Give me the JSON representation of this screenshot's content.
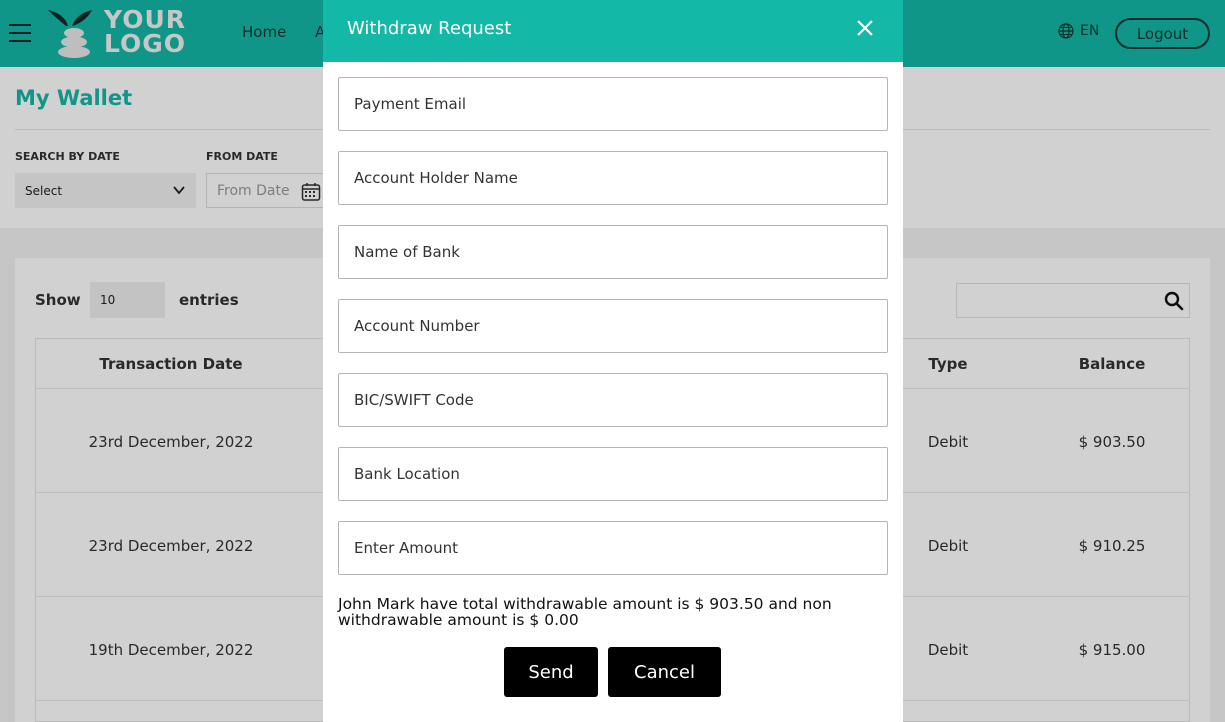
{
  "header": {
    "logo_text": "YOUR LOGO",
    "nav": [
      "Home",
      "A"
    ],
    "language": "EN",
    "logout_label": "Logout"
  },
  "page": {
    "title": "My Wallet",
    "search_by_date_label": "SEARCH BY DATE",
    "search_by_date_value": "Select",
    "from_date_label": "FROM DATE",
    "from_date_placeholder": "From Date"
  },
  "table_controls": {
    "show_label": "Show",
    "entries_value": "10",
    "entries_label": "entries"
  },
  "table": {
    "columns": [
      "Transaction Date",
      "Type",
      "Balance"
    ],
    "rows": [
      {
        "date": "23rd December, 2022",
        "type": "Debit",
        "balance": "$ 903.50"
      },
      {
        "date": "23rd December, 2022",
        "type": "Debit",
        "balance": "$ 910.25"
      },
      {
        "date": "19th December, 2022",
        "type": "Debit",
        "balance": "$ 915.00"
      }
    ]
  },
  "modal": {
    "title": "Withdraw Request",
    "fields": [
      {
        "placeholder": "Payment Email"
      },
      {
        "placeholder": "Account Holder Name"
      },
      {
        "placeholder": "Name of Bank"
      },
      {
        "placeholder": "Account Number"
      },
      {
        "placeholder": "BIC/SWIFT Code"
      },
      {
        "placeholder": "Bank Location"
      },
      {
        "placeholder": "Enter Amount"
      }
    ],
    "info_text": "John Mark have total withdrawable amount is $ 903.50 and non withdrawable amount is $ 0.00",
    "send_label": "Send",
    "cancel_label": "Cancel"
  },
  "colors": {
    "brand": "#14b8a6",
    "button": "#000000"
  }
}
